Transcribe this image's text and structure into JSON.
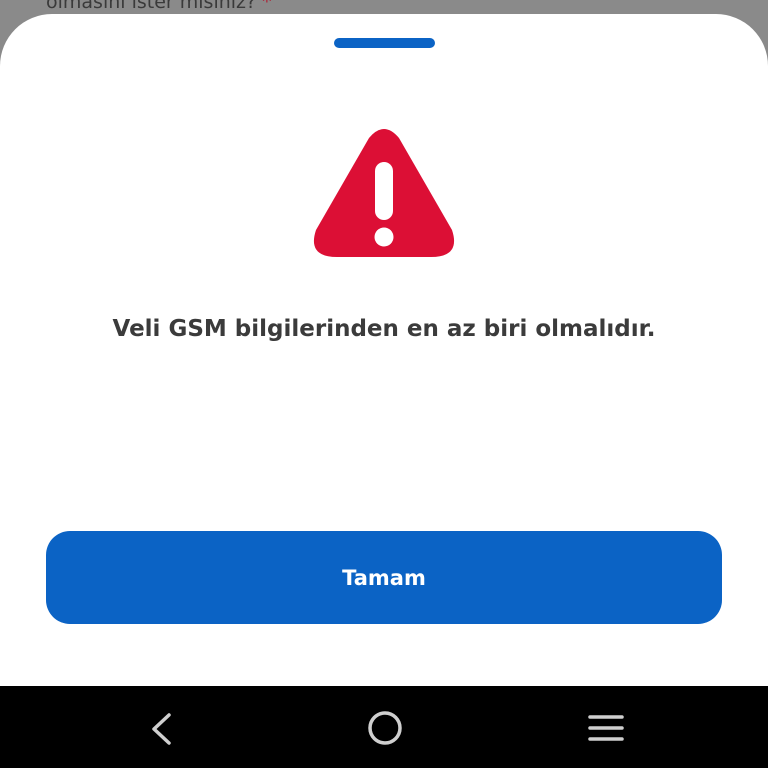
{
  "background": {
    "form_question": "olmasını ister misiniz?",
    "required_mark": "*"
  },
  "dialog": {
    "icon": "warning-triangle-icon",
    "icon_color": "#DC0F35",
    "message": "Veli GSM bilgilerinden en az biri olmalıdır.",
    "ok_label": "Tamam",
    "accent_color": "#0B63C5"
  },
  "navbar": {
    "back_icon": "chevron-left-icon",
    "home_icon": "circle-home-icon",
    "recents_icon": "menu-lines-icon"
  }
}
